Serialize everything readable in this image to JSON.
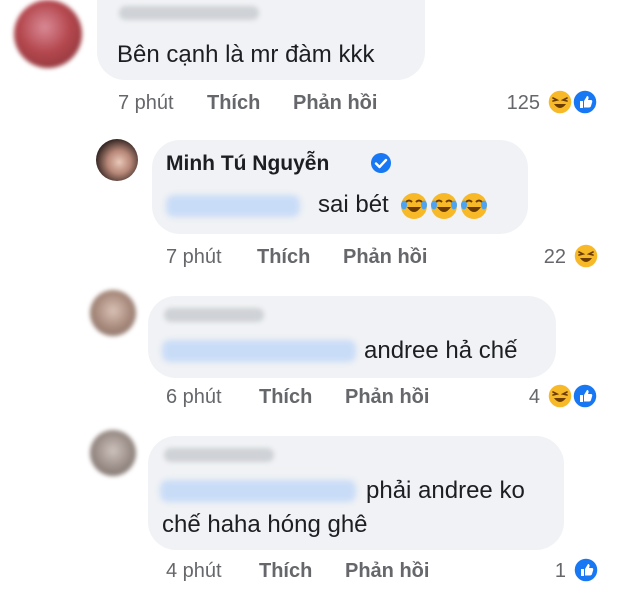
{
  "comments": [
    {
      "text": "Bên cạnh là mr đàm kkk",
      "time": "7 phút",
      "like_label": "Thích",
      "reply_label": "Phản hồi",
      "reaction_count": "125"
    },
    {
      "author": "Minh Tú Nguyễn",
      "text": "sai bét",
      "time": "7 phút",
      "like_label": "Thích",
      "reply_label": "Phản hồi",
      "reaction_count": "22"
    },
    {
      "text": "andree hả chế",
      "time": "6 phút",
      "like_label": "Thích",
      "reply_label": "Phản hồi",
      "reaction_count": "4"
    },
    {
      "text_line1": "phải andree ko",
      "text_line2": "chế haha hóng ghê",
      "time": "4 phút",
      "like_label": "Thích",
      "reply_label": "Phản hồi",
      "reaction_count": "1"
    }
  ],
  "colors": {
    "bubble": "#f0f2f5",
    "meta": "#65676b",
    "like_blue": "#1877f2",
    "haha_yellow": "#f7b928"
  }
}
